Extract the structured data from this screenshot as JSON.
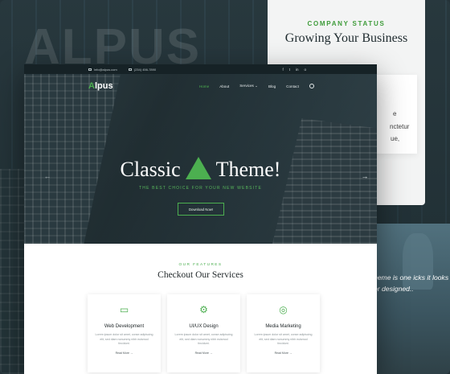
{
  "background": {
    "wordmark": "ALPUS"
  },
  "status_card": {
    "kicker": "COMPANY STATUS",
    "heading": "Growing Your Business",
    "fragments": [
      "e",
      "nctetur",
      "ue,"
    ]
  },
  "photo_strip": {
    "text": "heme is one icks it looks er designed.."
  },
  "topbar": {
    "email": "info@alpus.com",
    "phone": "(234) 456-7890",
    "social": [
      "f",
      "t",
      "in",
      "o"
    ]
  },
  "nav": {
    "logo_mark": "A",
    "logo_text": "lpus",
    "items": [
      "Home",
      "About",
      "Services ⌄",
      "Blog",
      "Contact"
    ]
  },
  "hero": {
    "headline_left": "Classic",
    "headline_right": "Theme!",
    "tagline": "THE BEST CHOICE FOR YOUR NEW WEBSITE",
    "cta": "Download Now!",
    "prev_glyph": "←",
    "next_glyph": "→"
  },
  "features": {
    "kicker": "OUR FEATURES",
    "title": "Checkout Our Services",
    "cards": [
      {
        "icon": "monitor-icon",
        "glyph": "▭",
        "name": "Web Development",
        "desc": "Lorem ipsum dolor sit amet, conse adipiscing elit, sed diam nonummy nibh euismod tincidunt.",
        "more": "Read More →"
      },
      {
        "icon": "gear-icon",
        "glyph": "⚙",
        "name": "UI/UX Design",
        "desc": "Lorem ipsum dolor sit amet, conse adipiscing elit, sed diam nonummy nibh euismod tincidunt.",
        "more": "Read More →"
      },
      {
        "icon": "target-icon",
        "glyph": "◎",
        "name": "Media Marketing",
        "desc": "Lorem ipsum dolor sit amet, conse adipiscing elit, sed diam nonummy nibh euismod tincidunt.",
        "more": "Read More →"
      }
    ]
  },
  "colors": {
    "accent": "#4caf50",
    "dark": "#162226"
  }
}
